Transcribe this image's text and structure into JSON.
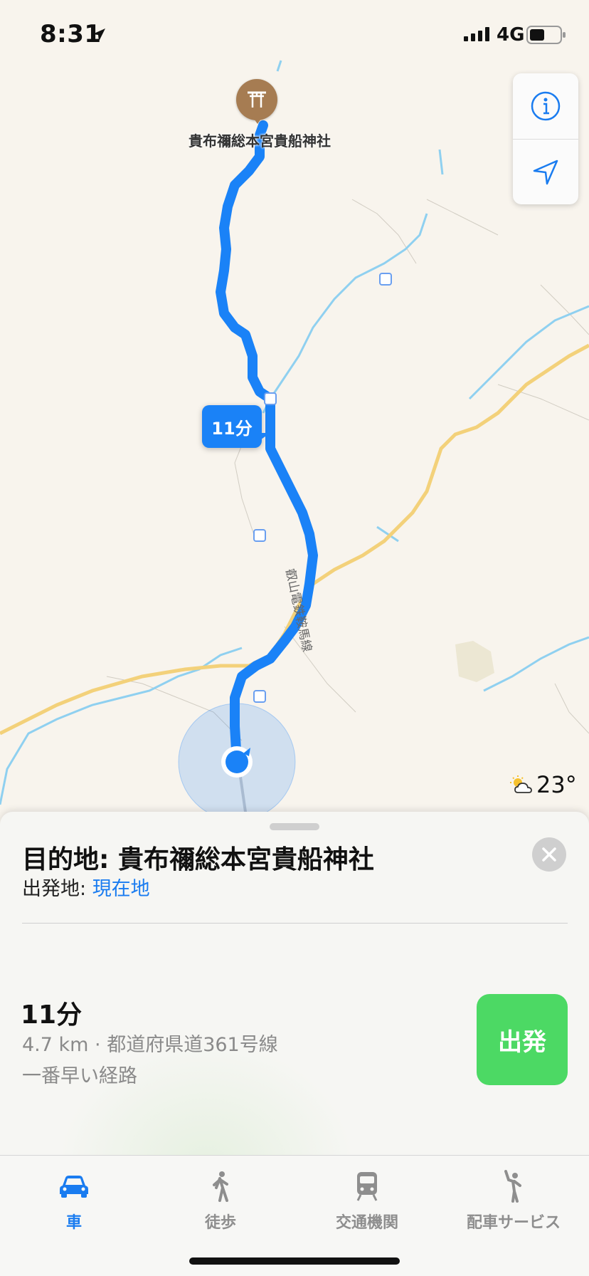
{
  "status_bar": {
    "time": "8:31",
    "network": "4G",
    "icons": [
      "location-arrow-icon",
      "signal-icon",
      "battery-icon"
    ]
  },
  "map": {
    "destination_pin_label": "貴布禰総本宮貴船神社",
    "destination_pin_icon": "torii-gate-icon",
    "eta_bubble": "11分",
    "road_label": "叡山電鉄鞍馬線",
    "weather_icon": "partly-cloudy-icon",
    "temperature": "23°",
    "controls": {
      "info_icon": "info-icon",
      "locate_icon": "navigation-arrow-icon"
    },
    "colors": {
      "route": "#1a82f7",
      "road": "#f3d17a",
      "river": "#8fd0f0",
      "user_dot": "#1a82f7"
    }
  },
  "sheet": {
    "title": "目的地: 貴布禰総本宮貴船神社",
    "origin_prefix": "出発地: ",
    "origin_value": "現在地",
    "route_time": "11分",
    "route_detail": "4.7 km · 都道府県道361号線",
    "route_note": "一番早い経路",
    "go_button": "出発",
    "colors": {
      "go": "#4cd964",
      "link": "#1a7cf0"
    }
  },
  "tabs": [
    {
      "label": "車",
      "icon": "car-icon",
      "active": true
    },
    {
      "label": "徒歩",
      "icon": "walk-icon",
      "active": false
    },
    {
      "label": "交通機関",
      "icon": "train-icon",
      "active": false
    },
    {
      "label": "配車サービス",
      "icon": "ride-hail-icon",
      "active": false
    }
  ]
}
